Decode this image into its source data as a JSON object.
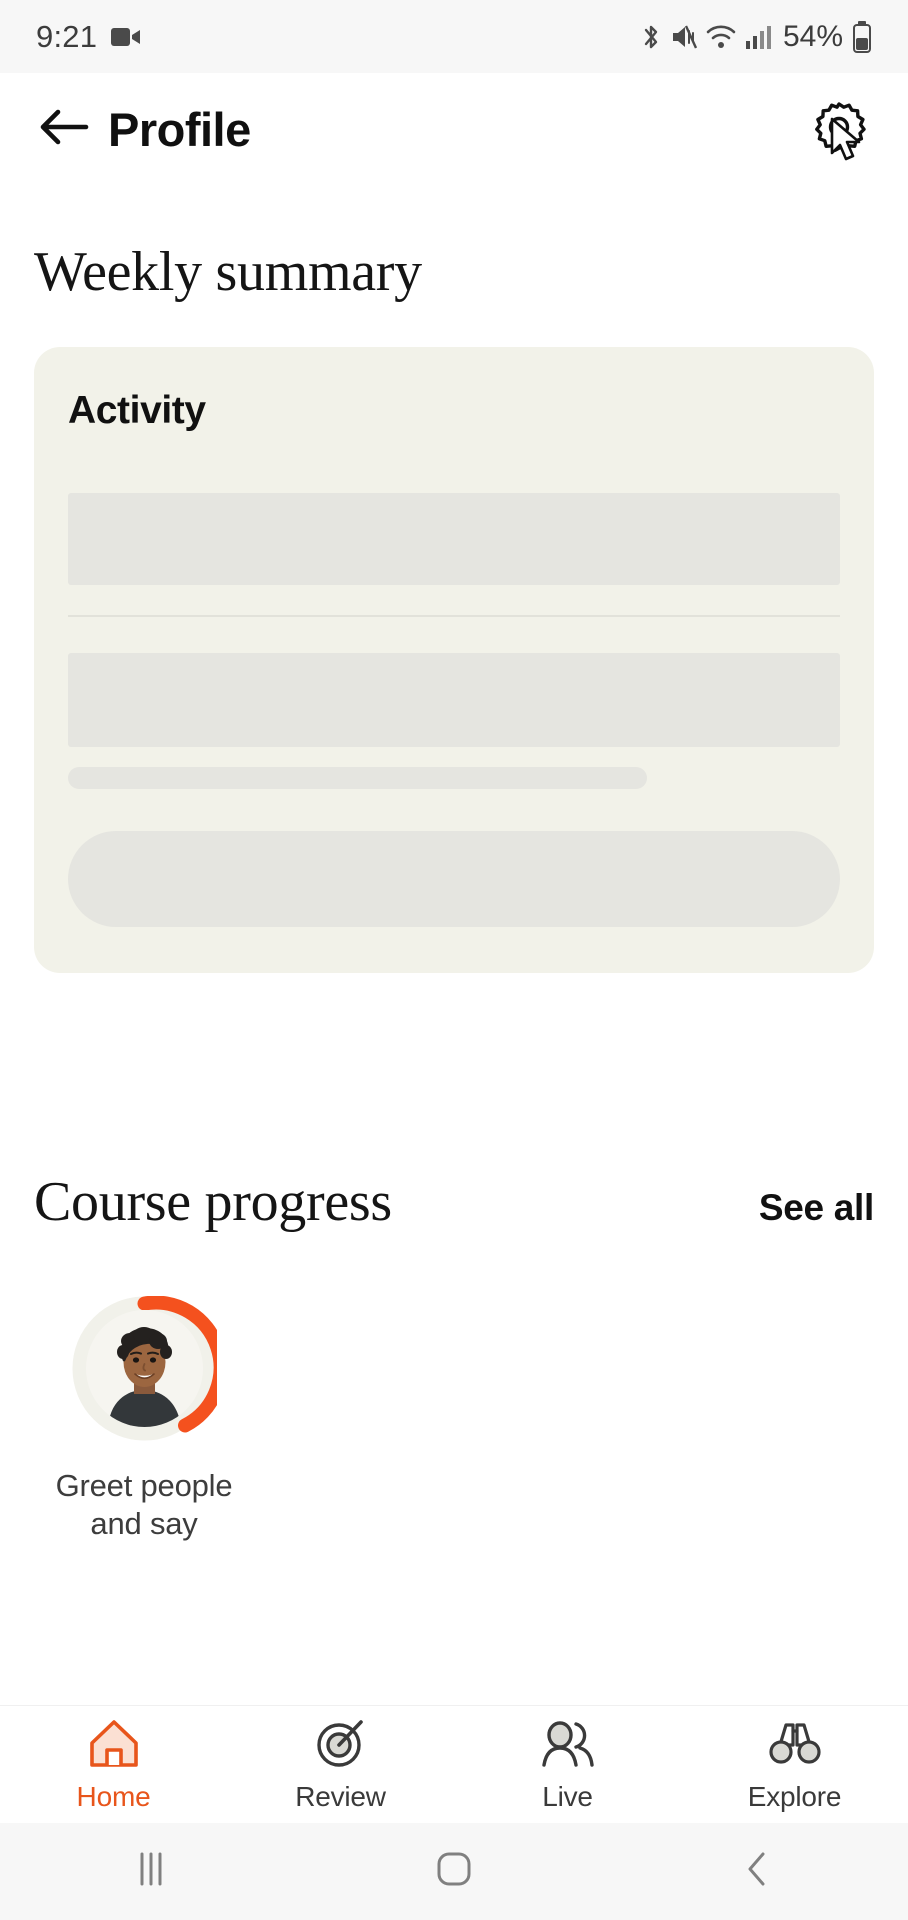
{
  "status_bar": {
    "time": "9:21",
    "battery_percent": "54%",
    "icons": [
      "video-record-icon",
      "bluetooth-icon",
      "mute-icon",
      "wifi-icon",
      "cellular-signal-icon",
      "battery-icon"
    ]
  },
  "header": {
    "title": "Profile",
    "back_icon": "arrow-left-icon",
    "settings_icon": "gear-icon",
    "cursor": "mouse-pointer-cursor"
  },
  "weekly_summary": {
    "title": "Weekly summary",
    "card": {
      "title": "Activity",
      "loading": true,
      "skeleton_items": [
        "block",
        "divider",
        "block",
        "short-bar",
        "pill"
      ]
    }
  },
  "course_progress": {
    "title": "Course progress",
    "see_all_label": "See all",
    "items": [
      {
        "label_line_1": "Greet people",
        "label_line_2": "and say",
        "progress_percent": 45,
        "ring_color": "#f4511e",
        "track_color": "#f1f1ea"
      }
    ]
  },
  "bottom_nav": {
    "active_index": 0,
    "active_color": "#e8551b",
    "items": [
      {
        "label": "Home",
        "icon": "home-icon"
      },
      {
        "label": "Review",
        "icon": "target-icon"
      },
      {
        "label": "Live",
        "icon": "people-icon"
      },
      {
        "label": "Explore",
        "icon": "binoculars-icon"
      }
    ]
  },
  "system_nav": {
    "recents_icon": "recent-apps-icon",
    "home_icon": "home-square-icon",
    "back_icon": "chevron-left-icon"
  }
}
